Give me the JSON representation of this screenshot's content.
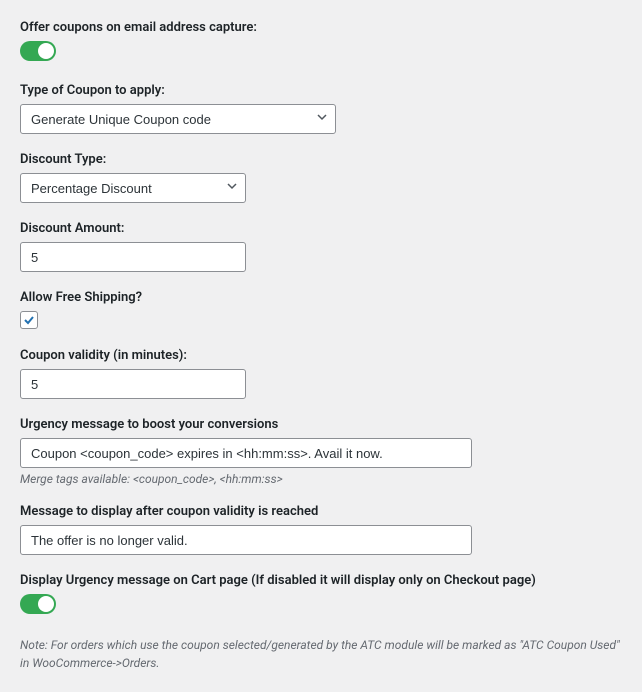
{
  "offer_coupons": {
    "label": "Offer coupons on email address capture:",
    "enabled": true
  },
  "coupon_type": {
    "label": "Type of Coupon to apply:",
    "value": "Generate Unique Coupon code"
  },
  "discount_type": {
    "label": "Discount Type:",
    "value": "Percentage Discount"
  },
  "discount_amount": {
    "label": "Discount Amount:",
    "value": "5"
  },
  "free_shipping": {
    "label": "Allow Free Shipping?",
    "checked": true
  },
  "coupon_validity": {
    "label": "Coupon validity (in minutes):",
    "value": "5"
  },
  "urgency_message": {
    "label": "Urgency message to boost your conversions",
    "value": "Coupon <coupon_code> expires in <hh:mm:ss>. Avail it now.",
    "help": "Merge tags available: <coupon_code>, <hh:mm:ss>"
  },
  "expired_message": {
    "label": "Message to display after coupon validity is reached",
    "value": "The offer is no longer valid."
  },
  "display_on_cart": {
    "label": "Display Urgency message on Cart page (If disabled it will display only on Checkout page)",
    "enabled": true
  },
  "note": "Note: For orders which use the coupon selected/generated by the ATC module will be marked as \"ATC Coupon Used\" in WooCommerce->Orders."
}
